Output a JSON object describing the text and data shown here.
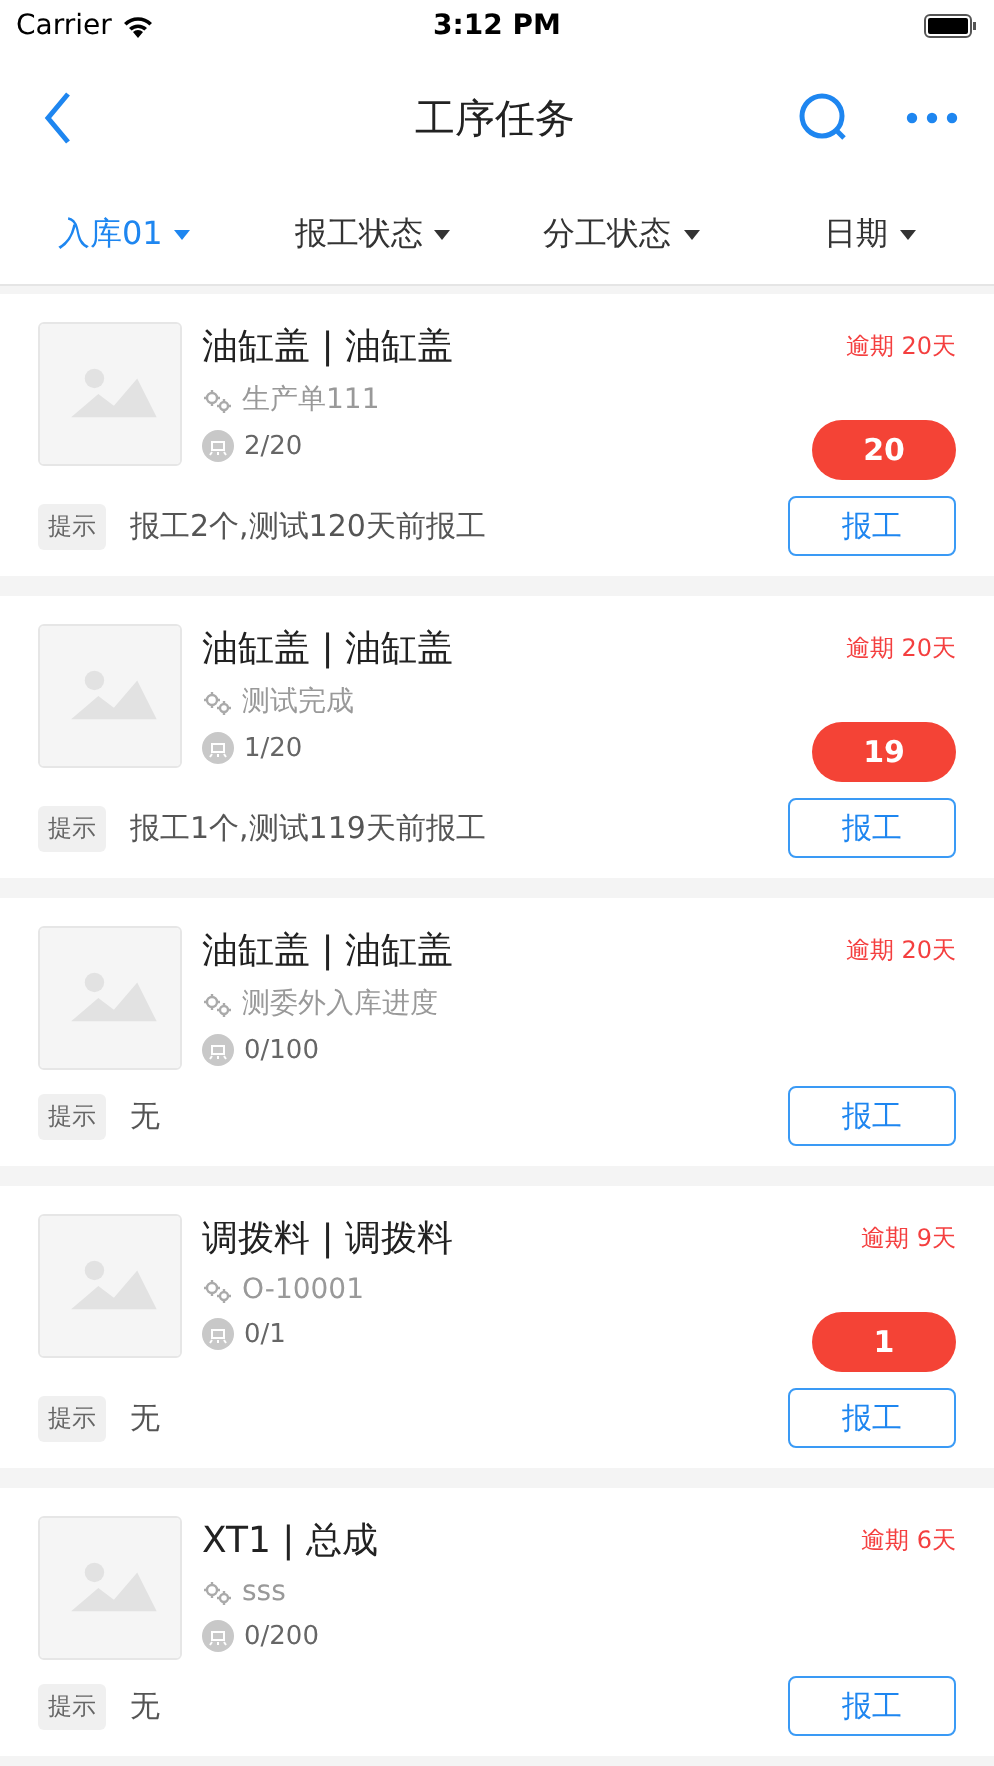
{
  "status_bar": {
    "carrier": "Carrier",
    "time": "3:12 PM"
  },
  "nav": {
    "title": "工序任务"
  },
  "filters": [
    {
      "label": "入库01",
      "selected": true
    },
    {
      "label": "报工状态",
      "selected": false
    },
    {
      "label": "分工状态",
      "selected": false
    },
    {
      "label": "日期",
      "selected": false
    }
  ],
  "tasks": [
    {
      "kind": "picture",
      "title": "油缸盖 | 油缸盖",
      "order": "生产单111",
      "progress": "2/20",
      "overdue": "逾期 20天",
      "count": "20",
      "hint_label": "提示",
      "hint": "报工2个,测试120天前报工",
      "action": "报工"
    },
    {
      "kind": "picture",
      "title": "油缸盖 | 油缸盖",
      "order": "测试完成",
      "progress": "1/20",
      "overdue": "逾期 20天",
      "count": "19",
      "hint_label": "提示",
      "hint": "报工1个,测试119天前报工",
      "action": "报工"
    },
    {
      "kind": "picture",
      "title": "油缸盖 | 油缸盖",
      "order": "测委外入库进度",
      "progress": "0/100",
      "overdue": "逾期 20天",
      "hint_label": "提示",
      "hint": "无",
      "action": "报工"
    },
    {
      "kind": "picture",
      "title": "调拨料 | 调拨料",
      "order": "O-10001",
      "progress": "0/1",
      "overdue": "逾期 9天",
      "count": "1",
      "hint_label": "提示",
      "hint": "无",
      "action": "报工"
    },
    {
      "kind": "picture",
      "title": "XT1 | 总成",
      "order": "sss",
      "progress": "0/200",
      "overdue": "逾期 6天",
      "hint_label": "提示",
      "hint": "无",
      "action": "报工"
    }
  ]
}
